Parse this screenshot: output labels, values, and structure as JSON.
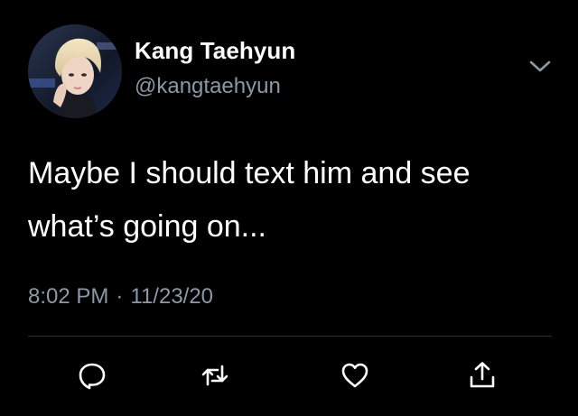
{
  "user": {
    "display_name": "Kang Taehyun",
    "handle": "@kangtaehyun",
    "avatar_icon": "profile-photo"
  },
  "tweet": {
    "text": "Maybe I should text him and see what’s going on...",
    "time": "8:02 PM",
    "separator": "·",
    "date": "11/23/20"
  },
  "actions": {
    "reply_icon": "reply-icon",
    "retweet_icon": "retweet-icon",
    "like_icon": "heart-icon",
    "share_icon": "share-icon"
  },
  "colors": {
    "background": "#000000",
    "primary_text": "#ffffff",
    "secondary_text": "#8b98a5",
    "divider": "#2f3336"
  }
}
